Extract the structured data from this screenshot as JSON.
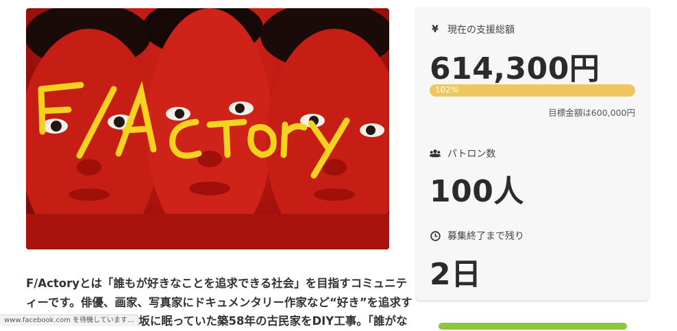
{
  "hero": {
    "painted_text": "F/ACtory"
  },
  "description": {
    "lines": [
      "F/Actoryとは「誰もが好きなことを追求できる社会」を目指すコミュニテ",
      "ィーです。俳優、画家、写真家にドキュメンタリー作家など“好き”を追求す",
      "る人々が集まり、神楽坂に眠っていた築58年の古民家をDIY工事。「誰がな"
    ]
  },
  "stats": {
    "funding_label": "現在の支援総額",
    "funding_value": "614,300円",
    "progress_text": "102%",
    "progress_percent": 102,
    "target_text": "目標金額は600,000円",
    "patrons_label": "パトロン数",
    "patrons_value": "100人",
    "remaining_label": "募集終了まで残り",
    "remaining_value": "2日"
  },
  "status_bar": {
    "text": "www.facebook.com を待機しています..."
  },
  "colors": {
    "progress": "#f0c75e",
    "paint_red": "#c41e16",
    "paint_yellow": "#f4d21f",
    "button_green": "#8cc63f"
  }
}
